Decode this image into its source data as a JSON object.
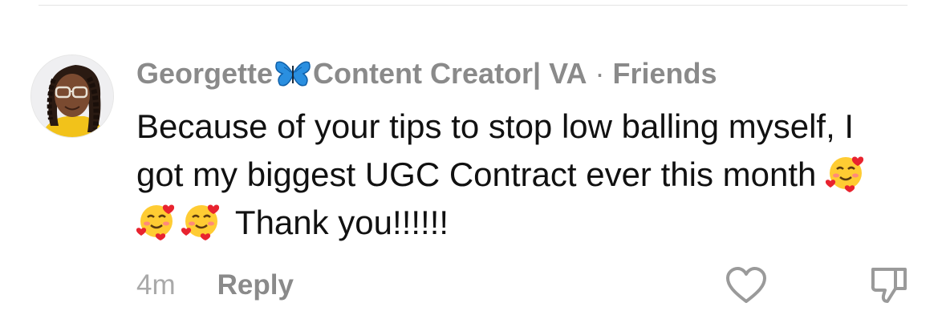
{
  "comment": {
    "author_name": "Georgette",
    "author_suffix": "Content Creator| VA",
    "separator": "·",
    "relation": "Friends",
    "text_before_emojis": "Because of your tips to stop low balling myself, I got my biggest UGC Contract ever this month ",
    "text_after_emojis": " Thank you!!!!!!",
    "emoji_name": "smiling-face-with-hearts-icon",
    "time": "4m",
    "reply_label": "Reply"
  },
  "icons": {
    "butterfly": "butterfly-icon",
    "like": "heart-icon",
    "dislike": "thumbs-down-icon"
  },
  "colors": {
    "meta_gray": "#8a8a8a",
    "text": "#111111",
    "butterfly_blue": "#2a8fe0"
  }
}
